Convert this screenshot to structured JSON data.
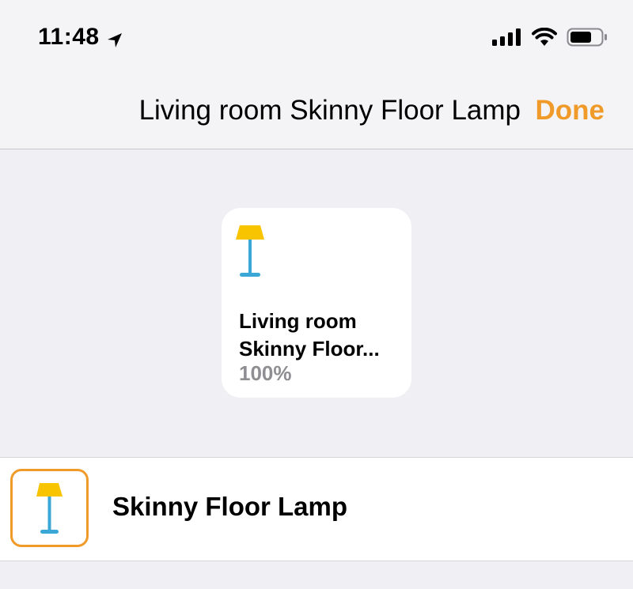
{
  "status_bar": {
    "time": "11:48",
    "location_icon": "location-arrow-icon",
    "signal_icon": "cellular-signal-icon",
    "wifi_icon": "wifi-icon",
    "battery_icon": "battery-icon"
  },
  "nav": {
    "title": "Living room Skinny Floor Lamp",
    "done_label": "Done"
  },
  "accessory_tile": {
    "icon": "floor-lamp-icon",
    "name_line1": "Living room",
    "name_line2": "Skinny Floor...",
    "state": "100%"
  },
  "accessory_row": {
    "icon": "floor-lamp-icon",
    "label": "Skinny Floor Lamp"
  },
  "colors": {
    "accent": "#f09a2a",
    "lamp_shade": "#f8c400",
    "lamp_stand": "#3aa7d6",
    "background": "#efeff4",
    "secondary_text": "#8e8e93"
  }
}
